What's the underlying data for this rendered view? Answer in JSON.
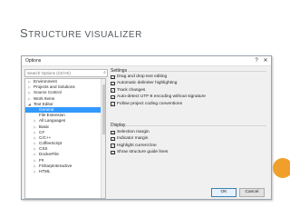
{
  "slide": {
    "title_first": "S",
    "title_rest": "TRUCTURE VISUALIZER"
  },
  "dialog": {
    "title": "Options",
    "help": "?",
    "close": "✕",
    "search": {
      "placeholder": "Search Options (Ctrl+E)"
    },
    "tree": [
      {
        "label": "Environment",
        "level": 0,
        "arrow": "▷",
        "selected": false
      },
      {
        "label": "Projects and Solutions",
        "level": 0,
        "arrow": "▷",
        "selected": false
      },
      {
        "label": "Source Control",
        "level": 0,
        "arrow": "▷",
        "selected": false
      },
      {
        "label": "Work Items",
        "level": 0,
        "arrow": "▷",
        "selected": false
      },
      {
        "label": "Text Editor",
        "level": 0,
        "arrow": "◢",
        "selected": false
      },
      {
        "label": "General",
        "level": 1,
        "arrow": "",
        "selected": true
      },
      {
        "label": "File Extension",
        "level": 1,
        "arrow": "",
        "selected": false
      },
      {
        "label": "All Languages",
        "level": 1,
        "arrow": "▷",
        "selected": false
      },
      {
        "label": "Basic",
        "level": 1,
        "arrow": "▷",
        "selected": false
      },
      {
        "label": "C#",
        "level": 1,
        "arrow": "▷",
        "selected": false
      },
      {
        "label": "C/C++",
        "level": 1,
        "arrow": "▷",
        "selected": false
      },
      {
        "label": "CoffeeScript",
        "level": 1,
        "arrow": "▷",
        "selected": false
      },
      {
        "label": "CSS",
        "level": 1,
        "arrow": "▷",
        "selected": false
      },
      {
        "label": "DockerFile",
        "level": 1,
        "arrow": "▷",
        "selected": false
      },
      {
        "label": "F#",
        "level": 1,
        "arrow": "▷",
        "selected": false
      },
      {
        "label": "FSharpInteractive",
        "level": 1,
        "arrow": "▷",
        "selected": false
      },
      {
        "label": "HTML",
        "level": 1,
        "arrow": "▷",
        "selected": false
      }
    ],
    "settings": {
      "header": "Settings",
      "options": [
        {
          "label": "Drag and drop text editing",
          "checked": true
        },
        {
          "label": "Automatic delimiter highlighting",
          "checked": true
        },
        {
          "label": "Track changes",
          "checked": true
        },
        {
          "label": "Auto-detect UTF-8 encoding without signature",
          "checked": true
        },
        {
          "label": "Follow project coding conventions",
          "checked": true
        }
      ]
    },
    "display": {
      "header": "Display",
      "options": [
        {
          "label": "Selection margin",
          "checked": true
        },
        {
          "label": "Indicator margin",
          "checked": true
        },
        {
          "label": "Highlight current line",
          "checked": true
        },
        {
          "label": "Show structure guide lines",
          "checked": true
        }
      ]
    },
    "ok_label": "OK",
    "cancel_label": "Cancel"
  },
  "colors": {
    "accent": "#3399ff",
    "orange_tab": "#f0a02a",
    "title_text": "#555a5e"
  }
}
